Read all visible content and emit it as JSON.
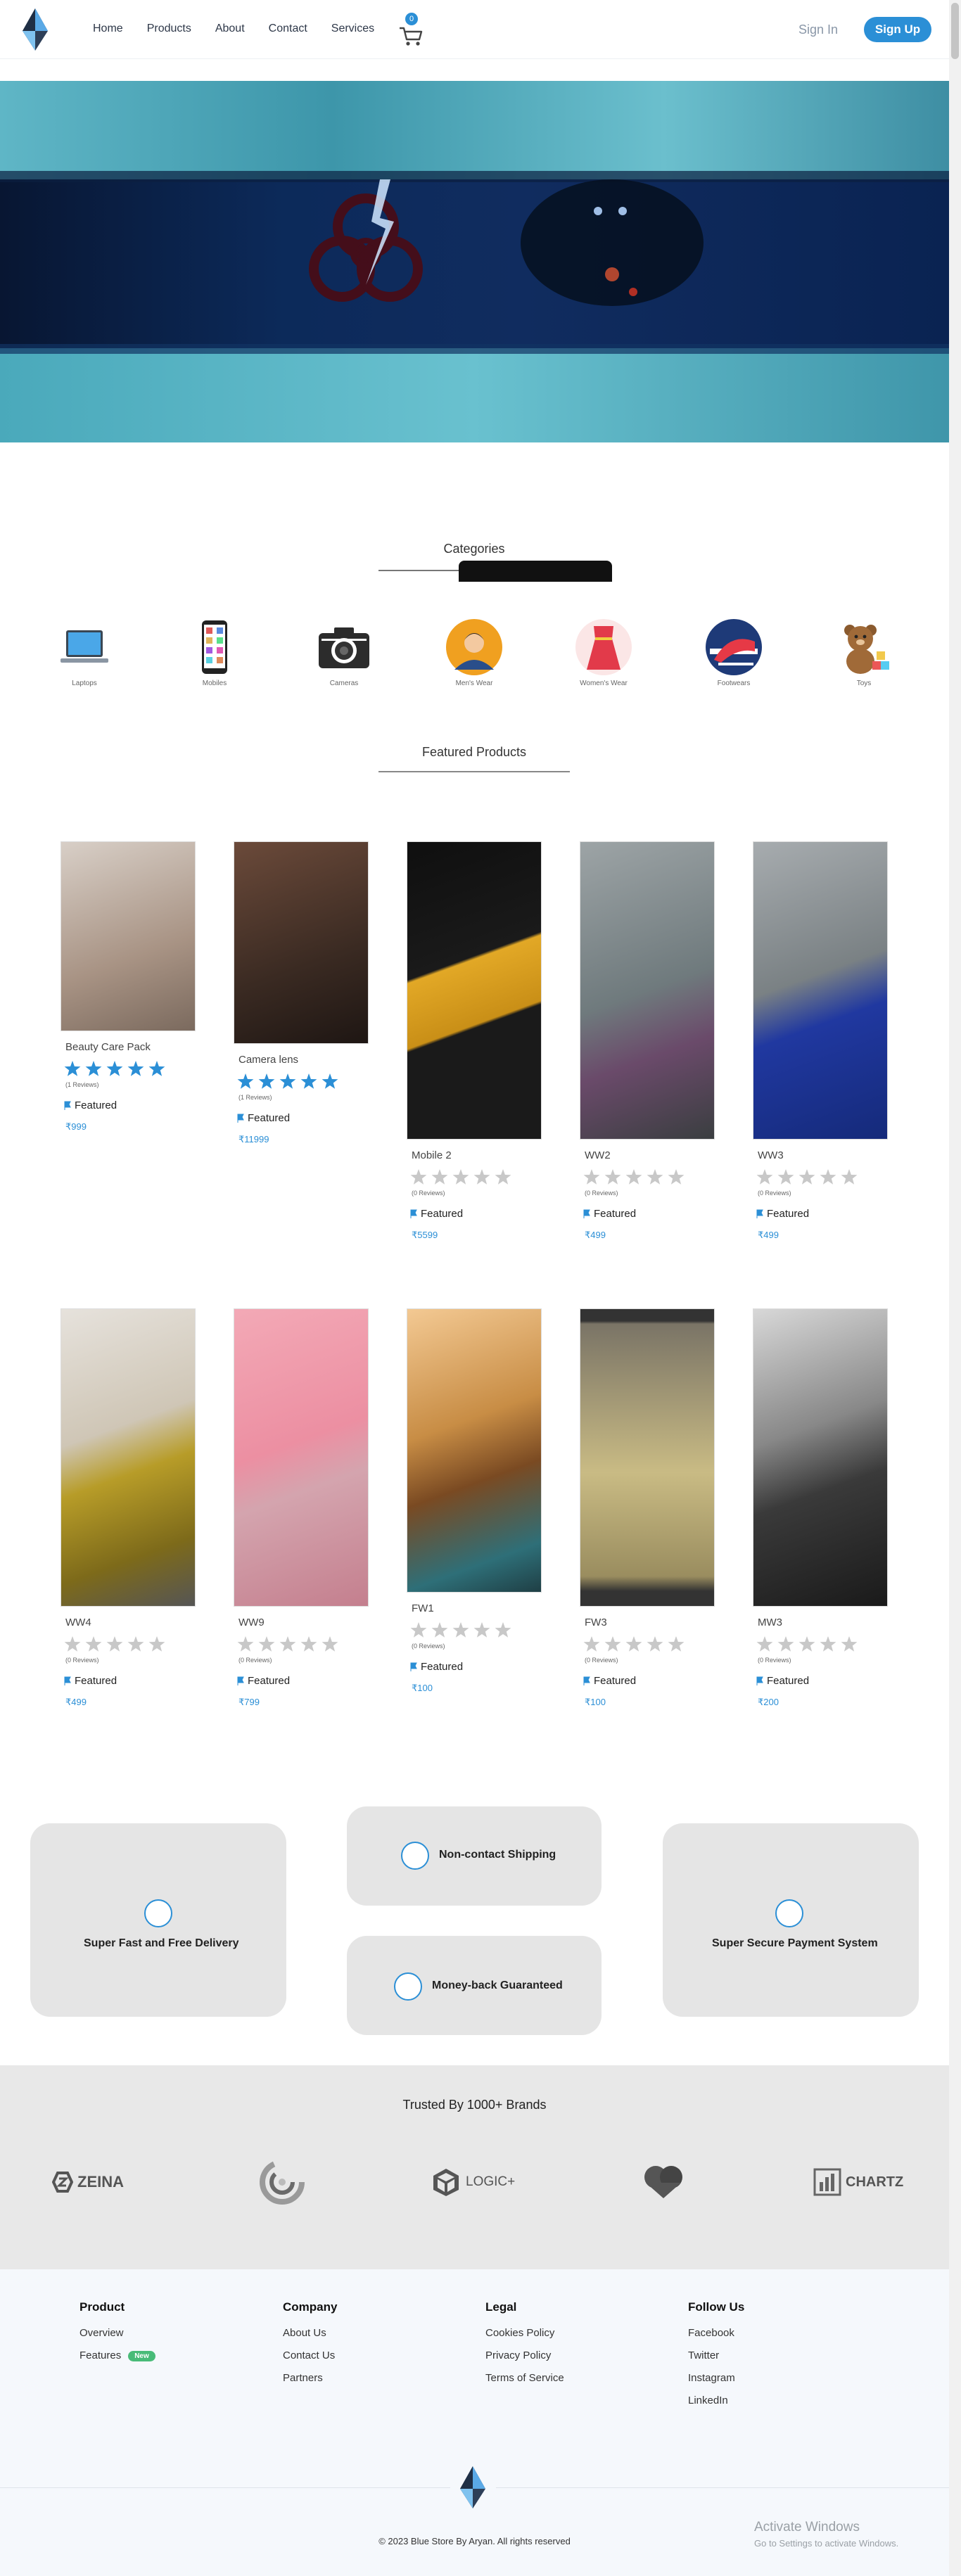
{
  "nav": {
    "links": [
      "Home",
      "Products",
      "About",
      "Contact",
      "Services"
    ],
    "cart_count": "0",
    "signin_label": "Sign In",
    "signup_label": "Sign Up"
  },
  "categories": {
    "title": "Categories",
    "items": [
      {
        "label": "Laptops",
        "icon": "laptop-icon"
      },
      {
        "label": "Mobiles",
        "icon": "mobile-icon"
      },
      {
        "label": "Cameras",
        "icon": "camera-icon"
      },
      {
        "label": "Men's Wear",
        "icon": "mens-wear-icon"
      },
      {
        "label": "Women's Wear",
        "icon": "womens-wear-icon"
      },
      {
        "label": "Footwears",
        "icon": "footwear-icon"
      },
      {
        "label": "Toys",
        "icon": "toy-icon"
      }
    ]
  },
  "featured": {
    "title": "Featured Products",
    "products": [
      {
        "name": "Beauty Care Pack",
        "rating": 5,
        "reviews": "(1 Reviews)",
        "badge": "Featured",
        "price": "₹999"
      },
      {
        "name": "Camera lens",
        "rating": 5,
        "reviews": "(1 Reviews)",
        "badge": "Featured",
        "price": "₹11999"
      },
      {
        "name": "Mobile 2",
        "rating": 0,
        "reviews": "(0 Reviews)",
        "badge": "Featured",
        "price": "₹5599"
      },
      {
        "name": "WW2",
        "rating": 0,
        "reviews": "(0 Reviews)",
        "badge": "Featured",
        "price": "₹499"
      },
      {
        "name": "WW3",
        "rating": 0,
        "reviews": "(0 Reviews)",
        "badge": "Featured",
        "price": "₹499"
      },
      {
        "name": "WW4",
        "rating": 0,
        "reviews": "(0 Reviews)",
        "badge": "Featured",
        "price": "₹499"
      },
      {
        "name": "WW9",
        "rating": 0,
        "reviews": "(0 Reviews)",
        "badge": "Featured",
        "price": "₹799"
      },
      {
        "name": "FW1",
        "rating": 0,
        "reviews": "(0 Reviews)",
        "badge": "Featured",
        "price": "₹100"
      },
      {
        "name": "FW3",
        "rating": 0,
        "reviews": "(0 Reviews)",
        "badge": "Featured",
        "price": "₹100"
      },
      {
        "name": "MW3",
        "rating": 0,
        "reviews": "(0 Reviews)",
        "badge": "Featured",
        "price": "₹200"
      }
    ]
  },
  "services": {
    "fast_delivery": "Super Fast and Free Delivery",
    "non_contact": "Non-contact Shipping",
    "money_back": "Money-back Guaranteed",
    "secure_payment": "Super Secure Payment System"
  },
  "trust": {
    "title": "Trusted By 1000+ Brands",
    "brands": [
      "ZEINA",
      "LOGIC+",
      "CHARTZ"
    ]
  },
  "footer": {
    "product": {
      "title": "Product",
      "links": [
        "Overview",
        "Features"
      ],
      "new_badge": "New"
    },
    "company": {
      "title": "Company",
      "links": [
        "About Us",
        "Contact Us",
        "Partners"
      ]
    },
    "legal": {
      "title": "Legal",
      "links": [
        "Cookies Policy",
        "Privacy Policy",
        "Terms of Service"
      ]
    },
    "follow": {
      "title": "Follow Us",
      "links": [
        "Facebook",
        "Twitter",
        "Instagram",
        "LinkedIn"
      ]
    },
    "copyright": "© 2023 Blue Store By Aryan. All rights reserved"
  },
  "watermark": {
    "line1": "Activate Windows",
    "line2": "Go to Settings to activate Windows."
  },
  "colors": {
    "accent": "#2b8fd6",
    "badge_new": "#48bb78",
    "star_filled": "#2b8fd6",
    "star_empty": "#c8c8c8"
  }
}
